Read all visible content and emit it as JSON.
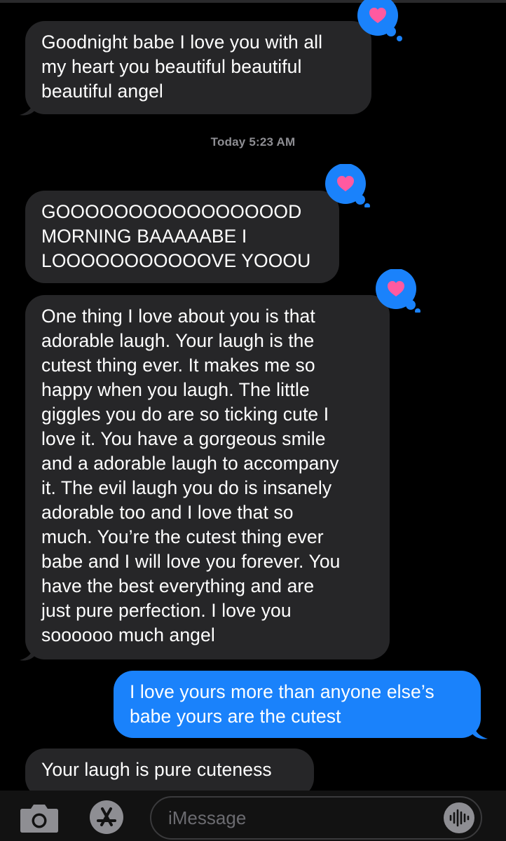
{
  "conversation": {
    "messages": [
      {
        "direction": "incoming",
        "text": "Goodnight babe I love you with all\nmy heart you beautiful beautiful\nbeautiful angel",
        "reaction": "heart"
      },
      {
        "direction": "incoming",
        "text": "GOOOOOOOOOOOOOOOOD\nMORNING BAAAAABE I\nLOOOOOOOOOOOVE YOOOU",
        "reaction": "heart"
      },
      {
        "direction": "incoming",
        "text": "One thing I love about you is that\nadorable laugh. Your laugh is the\ncutest thing ever. It makes me so\nhappy when you laugh. The little\ngiggles you do are so ticking cute I\nlove it. You have a gorgeous smile\nand a adorable laugh to accompany\nit. The evil laugh you do is insanely\nadorable too and I love that so\nmuch. You’re the cutest thing ever\nbabe and I will love you forever. You\nhave the best everything and are\njust pure perfection. I love you\nsoooooo much angel",
        "reaction": "heart"
      },
      {
        "direction": "outgoing",
        "text": "I love yours more than anyone else’s\nbabe yours are the cutest"
      },
      {
        "direction": "incoming",
        "text": "Your laugh is pure cuteness"
      }
    ],
    "timestamp": "Today 5:23 AM"
  },
  "composer": {
    "placeholder": "iMessage",
    "camera_icon": "camera-icon",
    "apps_icon": "app-store-icon",
    "audio_icon": "audio-waveform-icon"
  },
  "colors": {
    "incoming_bubble": "#262628",
    "outgoing_bubble": "#1a82fb",
    "tapback_badge": "#1a82fb",
    "tapback_heart": "#ff5aa0",
    "background": "#000000"
  }
}
